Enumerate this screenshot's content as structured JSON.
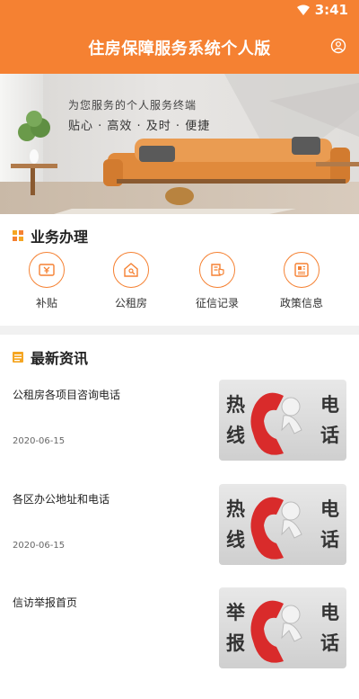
{
  "status": {
    "time": "3:41"
  },
  "header": {
    "title": "住房保障服务系统个人版"
  },
  "banner": {
    "line1": "为您服务的个人服务终端",
    "line2": "贴心 · 高效 · 及时 · 便捷"
  },
  "business": {
    "title": "业务办理",
    "items": [
      {
        "label": "补贴",
        "icon": "subsidy-icon"
      },
      {
        "label": "公租房",
        "icon": "public-housing-icon"
      },
      {
        "label": "征信记录",
        "icon": "credit-record-icon"
      },
      {
        "label": "政策信息",
        "icon": "policy-info-icon"
      }
    ]
  },
  "news": {
    "title": "最新资讯",
    "items": [
      {
        "title": "公租房各项目咨询电话",
        "date": "2020-06-15",
        "thumb": {
          "c1": "热",
          "c2": "线",
          "c3": "电",
          "c4": "话"
        }
      },
      {
        "title": "各区办公地址和电话",
        "date": "2020-06-15",
        "thumb": {
          "c1": "热",
          "c2": "线",
          "c3": "电",
          "c4": "话"
        }
      },
      {
        "title": "信访举报首页",
        "date": "",
        "thumb": {
          "c1": "举",
          "c2": "报",
          "c3": "电",
          "c4": "话"
        }
      }
    ]
  },
  "colors": {
    "accent": "#f58132",
    "divider": "#f1f1f1"
  }
}
